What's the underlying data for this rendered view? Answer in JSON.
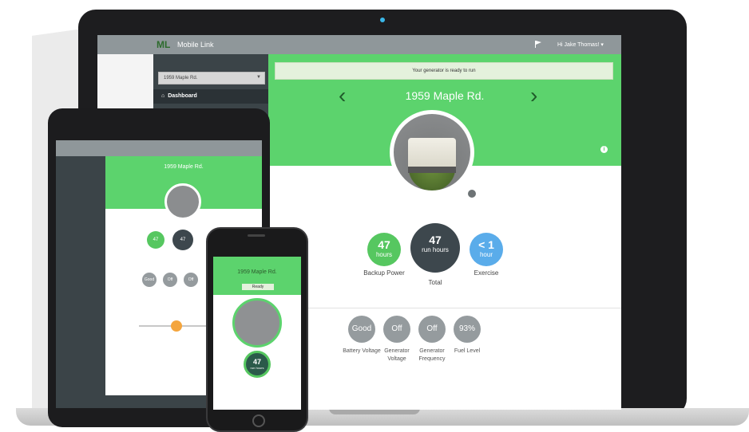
{
  "app": {
    "brand_logo": "ML",
    "brand_name": "Mobile Link",
    "user_menu": "Hi Jake Thomas! ▾"
  },
  "sidebar": {
    "location_select": "1959 Maple Rd.",
    "items": [
      {
        "label": "Dashboard",
        "icon": "home-icon"
      }
    ]
  },
  "main": {
    "banner": "Your generator is ready to run",
    "location_title": "1959 Maple Rd.",
    "stats": [
      {
        "value": "47",
        "unit": "hours",
        "label": "Backup Power",
        "color": "#56c760"
      },
      {
        "value": "47",
        "unit": "run hours",
        "label": "Total",
        "color": "#3d474d"
      },
      {
        "value": "< 1",
        "unit": "hour",
        "label": "Exercise",
        "color": "#5aacea"
      }
    ],
    "metrics": [
      {
        "value": "Good",
        "label": "Battery Voltage"
      },
      {
        "value": "Off",
        "label": "Generator Voltage"
      },
      {
        "value": "Off",
        "label": "Generator Frequency"
      },
      {
        "value": "93%",
        "label": "Fuel Level"
      }
    ]
  },
  "tablet": {
    "location_title": "1959 Maple Rd.",
    "stats": [
      "47",
      "47"
    ],
    "metrics": [
      "Good",
      "Off",
      "Off"
    ]
  },
  "phone": {
    "location_title": "1959 Maple Rd.",
    "status": "Ready",
    "stat_value": "47",
    "stat_unit": "run hours"
  },
  "colors": {
    "accent_green": "#5cd36d",
    "topbar_gray": "#8f979a",
    "sidebar_dark": "#3b4448",
    "metric_gray": "#959b9e"
  }
}
